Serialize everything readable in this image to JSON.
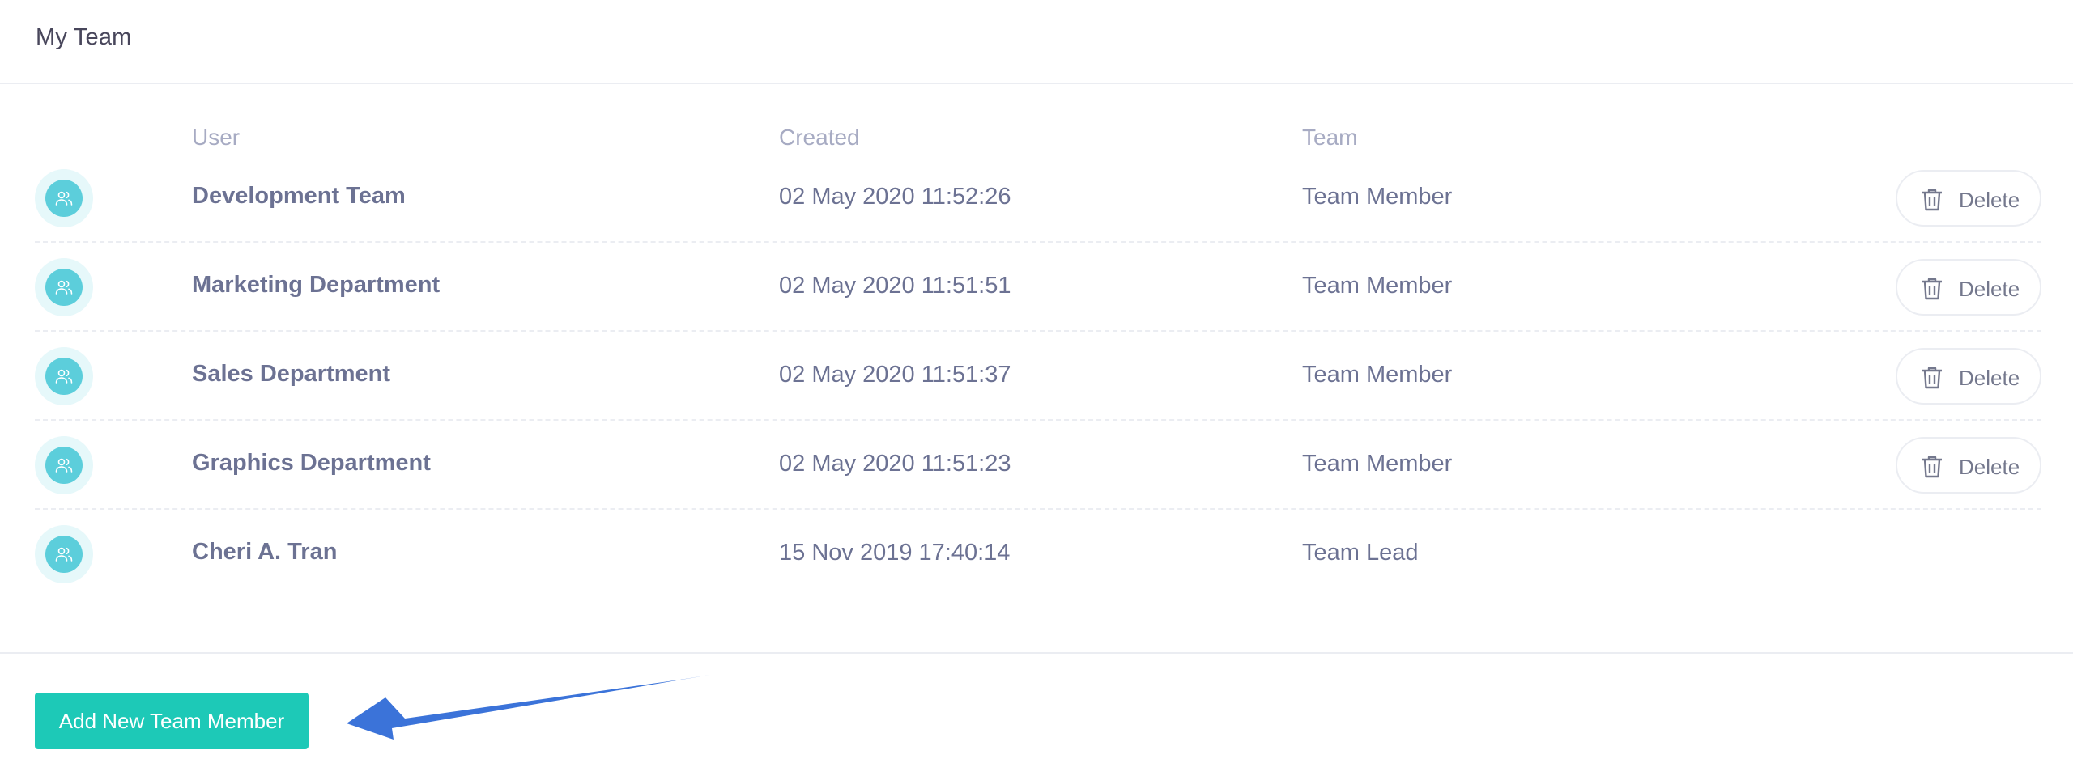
{
  "header": {
    "title": "My Team"
  },
  "table": {
    "columns": {
      "user": "User",
      "created": "Created",
      "team": "Team"
    },
    "rows": [
      {
        "user": "Development Team",
        "created": "02 May 2020 11:52:26",
        "team": "Team Member",
        "delete_label": "Delete"
      },
      {
        "user": "Marketing Department",
        "created": "02 May 2020 11:51:51",
        "team": "Team Member",
        "delete_label": "Delete"
      },
      {
        "user": "Sales Department",
        "created": "02 May 2020 11:51:37",
        "team": "Team Member",
        "delete_label": "Delete"
      },
      {
        "user": "Graphics Department",
        "created": "02 May 2020 11:51:23",
        "team": "Team Member",
        "delete_label": "Delete"
      },
      {
        "user": "Cheri A. Tran",
        "created": "15 Nov 2019 17:40:14",
        "team": "Team Lead"
      }
    ]
  },
  "footer": {
    "add_label": "Add New Team Member"
  },
  "colors": {
    "accent": "#1dc9b7",
    "avatar": "#5ccedb",
    "arrow": "#3b73d9"
  },
  "icons": {
    "avatar": "users-icon",
    "delete": "trash-icon",
    "annotation": "arrow-icon"
  }
}
